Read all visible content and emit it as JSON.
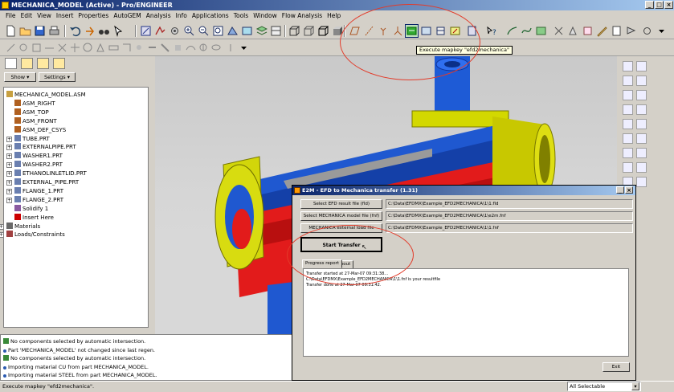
{
  "window": {
    "title": "MECHANICA_MODEL (Active) - Pro/ENGINEER"
  },
  "menu": [
    "File",
    "Edit",
    "View",
    "Insert",
    "Properties",
    "AutoGEM",
    "Analysis",
    "Info",
    "Applications",
    "Tools",
    "Window",
    "Flow Analysis",
    "Help"
  ],
  "tooltip": "Execute mapkey \"efd2mechanica\"",
  "left_panel": {
    "show_label": "Show",
    "settings_label": "Settings"
  },
  "tree": [
    {
      "label": "MECHANICA_MODEL.ASM",
      "icon": "assembly-icon",
      "indent": 0,
      "expander": ""
    },
    {
      "label": "ASM_RIGHT",
      "icon": "datum-plane-icon",
      "indent": 1,
      "expander": ""
    },
    {
      "label": "ASM_TOP",
      "icon": "datum-plane-icon",
      "indent": 1,
      "expander": ""
    },
    {
      "label": "ASM_FRONT",
      "icon": "datum-plane-icon",
      "indent": 1,
      "expander": ""
    },
    {
      "label": "ASM_DEF_CSYS",
      "icon": "csys-icon",
      "indent": 1,
      "expander": ""
    },
    {
      "label": "TUBE.PRT",
      "icon": "part-icon",
      "indent": 1,
      "expander": "+"
    },
    {
      "label": "EXTERNALPIPE.PRT",
      "icon": "part-icon",
      "indent": 1,
      "expander": "+"
    },
    {
      "label": "WASHER1.PRT",
      "icon": "part-icon",
      "indent": 1,
      "expander": "+"
    },
    {
      "label": "WASHER2.PRT",
      "icon": "part-icon",
      "indent": 1,
      "expander": "+"
    },
    {
      "label": "ETHANOLINLETLID.PRT",
      "icon": "part-icon",
      "indent": 1,
      "expander": "+"
    },
    {
      "label": "EXTERNAL_PIPE.PRT",
      "icon": "part-icon",
      "indent": 1,
      "expander": "+"
    },
    {
      "label": "FLANGE_1.PRT",
      "icon": "part-icon",
      "indent": 1,
      "expander": "+"
    },
    {
      "label": "FLANGE_2.PRT",
      "icon": "part-icon",
      "indent": 1,
      "expander": "+"
    },
    {
      "label": "Solidify 1",
      "icon": "solidify-icon",
      "indent": 1,
      "expander": ""
    },
    {
      "label": "Insert Here",
      "icon": "insert-arrow-icon",
      "indent": 1,
      "expander": ""
    },
    {
      "label": "Materials",
      "icon": "materials-icon",
      "indent": 0,
      "expander": "+"
    },
    {
      "label": "Loads/Constraints",
      "icon": "loads-icon",
      "indent": 0,
      "expander": "+"
    }
  ],
  "messages": [
    {
      "icon": "info-icon",
      "text": "No components selected by automatic intersection."
    },
    {
      "icon": "bullet-icon",
      "text": "Part 'MECHANICA_MODEL' not changed since last regen."
    },
    {
      "icon": "info-icon",
      "text": "No components selected by automatic intersection."
    },
    {
      "icon": "bullet-icon",
      "text": "Importing material CU from part MECHANICA_MODEL."
    },
    {
      "icon": "bullet-icon",
      "text": "Importing material STEEL from part MECHANICA_MODEL."
    }
  ],
  "status": {
    "text": "Execute mapkey \"efd2mechanica\".",
    "filter": "All Selectable"
  },
  "dialog": {
    "title": "E2M - EFD to Mechanica transfer (1.31)",
    "rows": [
      {
        "button": "Select EFD result file (fld)",
        "path": "C:\\Data\\EFDMX\\Example_EFD2MECHANICA\\1\\1.fld"
      },
      {
        "button": "Select MECHANICA model file (fnf)",
        "path": "C:\\Data\\EFDMX\\Example_EFD2MECHANICA\\1\\e2m.fnf"
      },
      {
        "button": "MECHANICA external load file",
        "path": "C:\\Data\\EFDMX\\Example_EFD2MECHANICA\\1\\1.fnf"
      }
    ],
    "start_label": "Start Transfer",
    "tabs": [
      "Progress report",
      "About"
    ],
    "report": [
      "Transfer started at 27-Mar-07 09:31:38...",
      "C:\\Data\\EFDMX\\Example_EFD2MECHANICA\\1\\1.fnf is your resultfile",
      "Transfer done at 27-Mar-07 09:31:42."
    ],
    "exit_label": "Exit"
  }
}
